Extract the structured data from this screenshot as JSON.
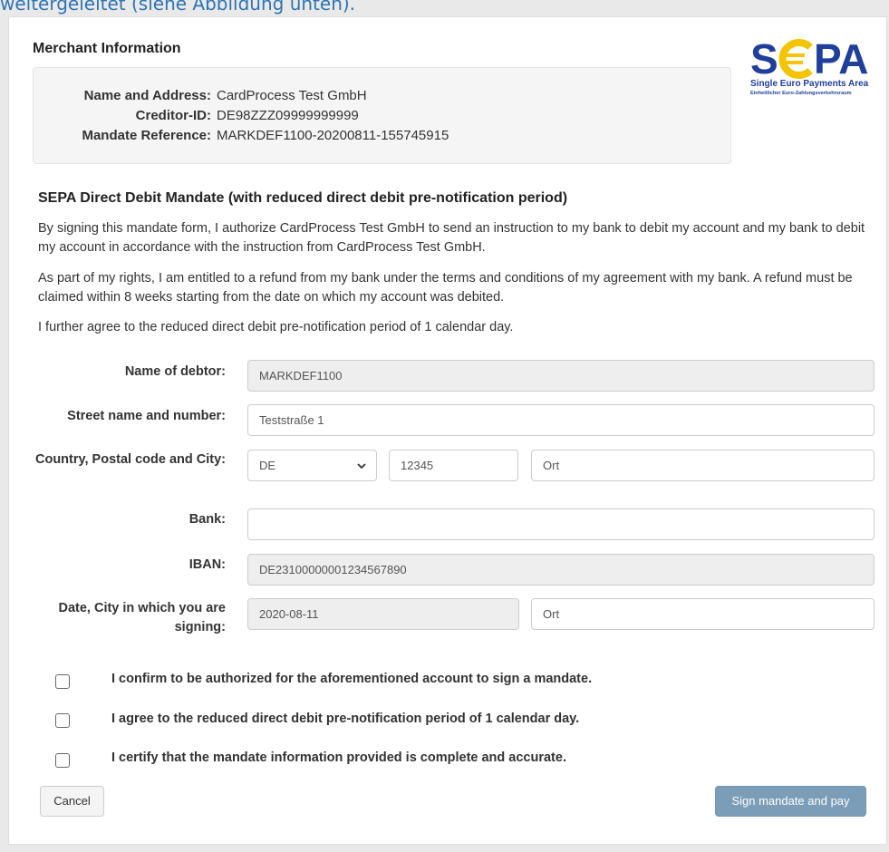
{
  "top_caption": "weitergeleitet (siehe Abbildung unten).",
  "merchant": {
    "title": "Merchant Information",
    "rows": [
      {
        "label": "Name and Address:",
        "value": "CardProcess Test GmbH"
      },
      {
        "label": "Creditor-ID:",
        "value": "DE98ZZZ09999999999"
      },
      {
        "label": "Mandate Reference:",
        "value": "MARKDEF1100-20200811-155745915"
      }
    ]
  },
  "logo": {
    "text": "SEPA",
    "line1": "Single Euro Payments Area",
    "line2": "Einheitlicher Euro-Zahlungsverkehrsraum",
    "colors": {
      "blue": "#1f3f9a",
      "yellow": "#f5c400"
    }
  },
  "mandate": {
    "title": "SEPA Direct Debit Mandate (with reduced direct debit pre-notification period)",
    "paragraphs": [
      "By signing this mandate form, I authorize CardProcess Test GmbH to send an instruction to my bank to debit my account and my bank to debit my account in accordance with the instruction from CardProcess Test GmbH.",
      "As part of my rights, I am entitled to a refund from my bank under the terms and conditions of my agreement with my bank. A refund must be claimed within 8 weeks starting from the date on which my account was debited.",
      "I further agree to the reduced direct debit pre-notification period of 1 calendar day."
    ]
  },
  "form": {
    "debtor_name": {
      "label": "Name of debtor:",
      "value": "MARKDEF1100"
    },
    "street": {
      "label": "Street name and number:",
      "value": "Teststraße 1"
    },
    "country_postal_city": {
      "label": "Country, Postal code and City:",
      "country": "DE",
      "postal": "12345",
      "city": "Ort"
    },
    "bank": {
      "label": "Bank:",
      "value": ""
    },
    "iban": {
      "label": "IBAN:",
      "value": "DE23100000001234567890"
    },
    "date_city": {
      "label": "Date, City in which you are signing:",
      "date": "2020-08-11",
      "city": "Ort"
    }
  },
  "confirmations": [
    {
      "label": "I confirm to be authorized for the aforementioned account to sign a mandate.",
      "checked": false
    },
    {
      "label": "I agree to the reduced direct debit pre-notification period of 1 calendar day.",
      "checked": false
    },
    {
      "label": "I certify that the mandate information provided is complete and accurate.",
      "checked": false
    }
  ],
  "buttons": {
    "cancel": "Cancel",
    "sign": "Sign mandate and pay"
  },
  "colors": {
    "sign_button": "#7c9db8",
    "readonly_field": "#eeeeee",
    "caption": "#2e74b5"
  }
}
